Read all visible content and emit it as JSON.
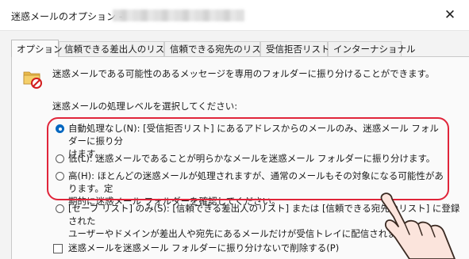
{
  "window": {
    "title": "迷惑メールのオプション -",
    "close_glyph": "✕"
  },
  "tabs": [
    {
      "label": "オプション",
      "active": true
    },
    {
      "label": "信頼できる差出人のリスト",
      "active": false
    },
    {
      "label": "信頼できる宛先のリスト",
      "active": false
    },
    {
      "label": "受信拒否リスト",
      "active": false
    },
    {
      "label": "インターナショナル",
      "active": false
    }
  ],
  "intro_text": "迷惑メールである可能性のあるメッセージを専用のフォルダーに振り分けることができます。",
  "section_label": "迷惑メールの処理レベルを選択してください:",
  "options": [
    {
      "lines": [
        "自動処理なし(N): [受信拒否リスト] にあるアドレスからのメールのみ、迷惑メール フォルダーに振り分",
        "けます。"
      ],
      "selected": true
    },
    {
      "lines": [
        "低(L): 迷惑メールであることが明らかなメールを迷惑メール フォルダーに振り分けます。"
      ],
      "selected": false
    },
    {
      "lines": [
        "高(H): ほとんどの迷惑メールが処理されますが、通常のメールもその対象になる可能性があります。定",
        "期的に迷惑メール フォルダーを確認してください。"
      ],
      "selected": false
    },
    {
      "lines": [
        "[セーフ リスト] のみ(S): [信頼できる差出人のリスト] または [信頼できる宛先のリスト] に登録された",
        "ユーザーやドメインが差出人や宛先にあるメールだけが受信トレイに配信されます。"
      ],
      "selected": false
    }
  ],
  "delete_checkbox": {
    "label": "迷惑メールを迷惑メール フォルダーに振り分けないで削除する(P)",
    "checked": false
  },
  "icons": {
    "options_icon": "junk-mail-folder-icon",
    "close": "close-icon"
  },
  "colors": {
    "accent": "#0067c0",
    "highlight": "#e0253a"
  }
}
